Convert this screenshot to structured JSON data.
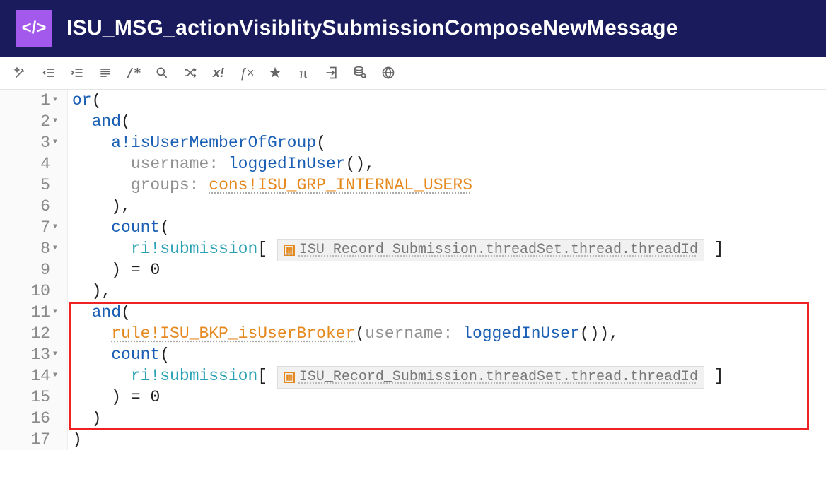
{
  "header": {
    "icon_label": "</>",
    "title": "ISU_MSG_actionVisiblitySubmissionComposeNewMessage"
  },
  "toolbar": {
    "items": [
      "magic-wand-icon",
      "outdent-icon",
      "indent-icon",
      "format-lines-icon",
      "comment-icon",
      "search-icon",
      "shuffle-icon",
      "x-bang-icon",
      "fx-icon",
      "star-icon",
      "pi-icon",
      "export-icon",
      "database-icon",
      "globe-icon"
    ],
    "labels": {
      "comment": "/*",
      "xbang": "x!",
      "fx": "ƒ×",
      "pi": "π"
    }
  },
  "gutter": {
    "lines": [
      {
        "n": "1",
        "fold": true
      },
      {
        "n": "2",
        "fold": true
      },
      {
        "n": "3",
        "fold": true
      },
      {
        "n": "4",
        "fold": false
      },
      {
        "n": "5",
        "fold": false
      },
      {
        "n": "6",
        "fold": false
      },
      {
        "n": "7",
        "fold": true
      },
      {
        "n": "8",
        "fold": true
      },
      {
        "n": "9",
        "fold": false
      },
      {
        "n": "10",
        "fold": false
      },
      {
        "n": "11",
        "fold": true
      },
      {
        "n": "12",
        "fold": false
      },
      {
        "n": "13",
        "fold": true
      },
      {
        "n": "14",
        "fold": true
      },
      {
        "n": "15",
        "fold": false
      },
      {
        "n": "16",
        "fold": false
      },
      {
        "n": "17",
        "fold": false
      }
    ]
  },
  "code": {
    "fn_or": "or",
    "fn_and": "and",
    "fn_isUserMemberOfGroup": "a!isUserMemberOfGroup",
    "kw_username": "username:",
    "fn_loggedInUser": "loggedInUser",
    "kw_groups": "groups:",
    "cons_internal_users": "cons!ISU_GRP_INTERNAL_USERS",
    "fn_count": "count",
    "ri_submission": "ri!submission",
    "record_path": "ISU_Record_Submission.threadSet.thread.threadId",
    "eq_zero": " = 0",
    "rule_isUserBroker": "rule!ISU_BKP_isUserBroker",
    "paren_open": "(",
    "paren_close": ")",
    "comma": ",",
    "bracket_open": "[",
    "bracket_close": "]"
  }
}
